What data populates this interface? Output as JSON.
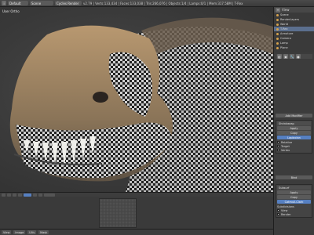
{
  "topbar": {
    "editor_menu": "Default",
    "scene_field": "Scene",
    "engine_field": "Cycles Render",
    "stats": "v2.79 | Verts:133,434 | Faces:133,038 | Tris:266,076 | Objects:1/4 | Lamps:0/1 | Mem:317.58M | T-Rex"
  },
  "viewport": {
    "label": "User Ortho"
  },
  "outliner": {
    "header": "View",
    "rows": [
      {
        "label": "Scene",
        "selected": false
      },
      {
        "label": "RenderLayers",
        "selected": false
      },
      {
        "label": "World",
        "selected": false
      },
      {
        "label": "T-Rex",
        "selected": true
      },
      {
        "label": "Armature",
        "selected": false
      },
      {
        "label": "Camera",
        "selected": false
      },
      {
        "label": "Lamp",
        "selected": false
      },
      {
        "label": "Plane",
        "selected": false
      }
    ]
  },
  "properties": {
    "add_modifier": "Add Modifier",
    "panel1": {
      "title": "Shrinkwrap",
      "buttons": [
        "Apply",
        "Copy"
      ],
      "active_button": "Laplacian",
      "checks": [
        "Relative",
        "Target",
        "Vertex"
      ]
    },
    "bind_button": "Bind",
    "panel2": {
      "title": "Subsurf",
      "buttons": [
        "Apply",
        "Copy"
      ],
      "active_button": "Catmull-Clark",
      "checks": [
        "Subdivisions",
        "View",
        "Render"
      ]
    }
  },
  "uv_footer": {
    "buttons": [
      "View",
      "Image",
      "UVs",
      "Mask"
    ]
  }
}
